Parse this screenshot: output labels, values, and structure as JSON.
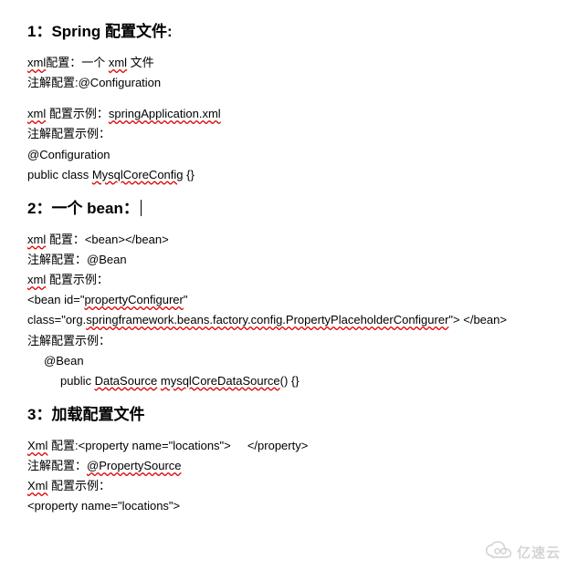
{
  "sections": {
    "s1": {
      "heading": "1：Spring 配置文件:",
      "l1_pre": "xml",
      "l1_mid": "配置：一个 ",
      "l1_u": "xml",
      "l1_post": " 文件",
      "l2": "注解配置:@Configuration",
      "l3_pre": "xml",
      "l3_mid": " 配置示例：",
      "l3_u": "springApplication.xml",
      "l4": "注解配置示例：",
      "l5": "@Configuration",
      "l6_pre": "public class ",
      "l6_u": "MysqlCoreConfig",
      "l6_post": " {}"
    },
    "s2": {
      "heading": "2：一个 bean：",
      "l1_pre": "xml",
      "l1_mid": " 配置：",
      "l1_code": "<bean></bean>",
      "l2": "注解配置：@Bean",
      "l3_pre": "xml",
      "l3_post": " 配置示例：",
      "l4_a": "<bean   id=\"",
      "l4_u": "propertyConfigurer",
      "l4_b": "\"",
      "l5_a": "class=\"org.",
      "l5_u": "springframework.beans.factory.config.PropertyPlaceholderConfigurer",
      "l5_b": "\">    </bean>",
      "l6": "注解配置示例：",
      "l7": "@Bean",
      "l8_a": "public ",
      "l8_u1": "DataSource",
      "l8_b": " ",
      "l8_u2": "mysqlCoreDataSource",
      "l8_c": "() {}"
    },
    "s3": {
      "heading": "3：加载配置文件",
      "l1_pre": "Xml",
      "l1_mid": " 配置:",
      "l1_code_a": "<property name=\"locations\">",
      "l1_code_b": "</property>",
      "l2_a": "注解配置：",
      "l2_u": "@PropertySource",
      "l3_pre": "Xml",
      "l3_post": " 配置示例：",
      "l4": "<property name=\"locations\">"
    }
  },
  "watermark": {
    "text": "亿速云"
  }
}
